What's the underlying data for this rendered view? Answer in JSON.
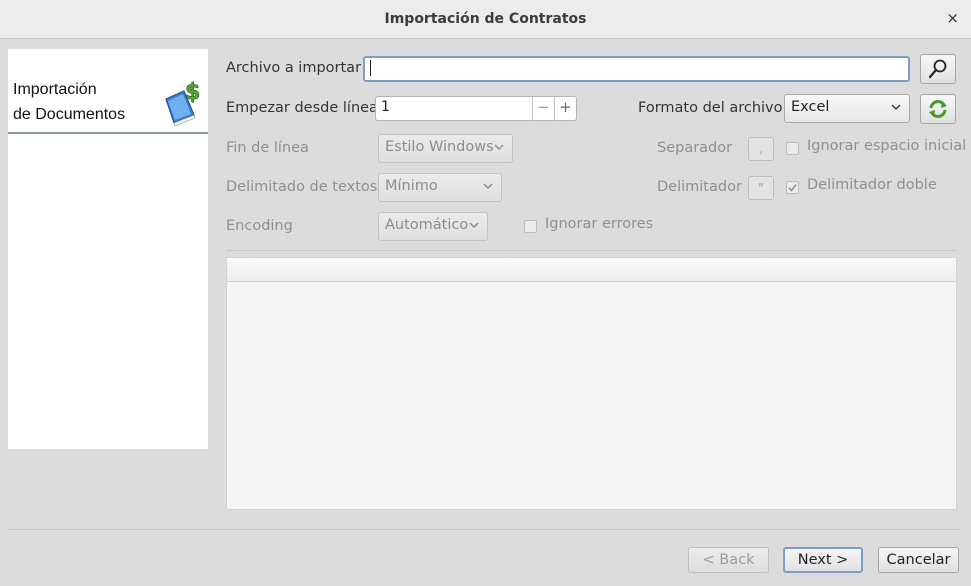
{
  "window": {
    "title": "Importación de Contratos",
    "close_glyph": "×"
  },
  "sidebar": {
    "title_line1": "Importación",
    "title_line2": "de Documentos",
    "icon": "dollar-document-icon"
  },
  "form": {
    "file_label": "Archivo a importar",
    "file_value": "",
    "start_line_label": "Empezar desde línea",
    "start_line_value": "1",
    "format_label": "Formato del archivo",
    "format_value": "Excel",
    "eol_label": "Fin de línea",
    "eol_value": "Estilo Windows",
    "text_delim_label": "Delimitado de textos",
    "text_delim_value": "Mínimo",
    "encoding_label": "Encoding",
    "encoding_value": "Automático",
    "ignore_errors_label": "Ignorar errores",
    "separator_label": "Separador",
    "separator_value": ",",
    "ignore_space_label": "Ignorar espacio inicial",
    "delimiter_label": "Delimitador",
    "delimiter_value": "\"",
    "double_delim_label": "Delimitador doble",
    "ignore_space_checked": false,
    "double_delim_checked": true,
    "ignore_errors_checked": false,
    "stepper_minus": "−",
    "stepper_plus": "+"
  },
  "footer": {
    "back_label": "< Back",
    "next_label": "Next >",
    "cancel_label": "Cancelar"
  },
  "colors": {
    "accent_focus": "#7a9ec6",
    "icon_green": "#4a9a2a",
    "icon_blue": "#2f6fb7"
  }
}
